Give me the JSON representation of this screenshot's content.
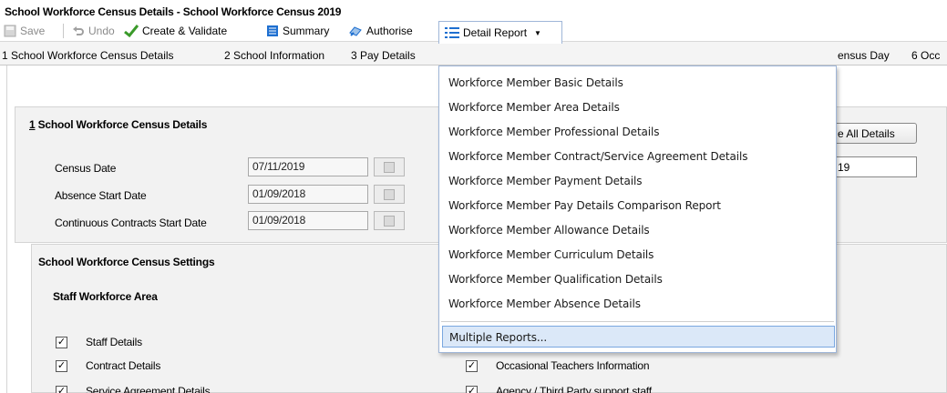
{
  "window": {
    "title": "School Workforce Census Details - School Workforce Census 2019"
  },
  "toolbar": {
    "save": "Save",
    "undo": "Undo",
    "create_validate": "Create & Validate",
    "summary": "Summary",
    "authorise": "Authorise",
    "detail_report": "Detail Report"
  },
  "tabs": [
    "1 School Workforce Census Details",
    "2 School Information",
    "3 Pay Details",
    "ensus Day",
    "6 Occ"
  ],
  "details": {
    "heading_number": "1",
    "heading_text": " School Workforce Census Details",
    "census_date_label": "Census Date",
    "census_date_value": "07/11/2019",
    "absence_start_label": "Absence Start Date",
    "absence_start_value": "01/09/2018",
    "contracts_start_label": "Continuous Contracts Start Date",
    "contracts_start_value": "01/09/2018",
    "all_details_button": "e All Details",
    "right_input_value": "19"
  },
  "settings": {
    "heading": "School Workforce Census Settings",
    "area_heading": "Staff Workforce Area",
    "checkboxes_left": [
      {
        "label": "Staff Details",
        "checked": true
      },
      {
        "label": "Contract Details",
        "checked": true
      },
      {
        "label": "Service Agreement Details",
        "checked": true
      }
    ],
    "checkboxes_right": [
      {
        "label": "Occasional Teachers Information",
        "checked": true
      },
      {
        "label": "Agency / Third Party support staff",
        "checked": true
      }
    ]
  },
  "menu": {
    "items": [
      "Workforce Member Basic Details",
      "Workforce Member Area Details",
      "Workforce Member Professional Details",
      "Workforce Member Contract/Service Agreement Details",
      "Workforce Member Payment Details",
      "Workforce Member Pay Details Comparison Report",
      "Workforce Member Allowance Details",
      "Workforce Member Curriculum Details",
      "Workforce Member Qualification Details",
      "Workforce Member Absence Details"
    ],
    "multiple": "Multiple Reports..."
  },
  "colors": {
    "menu_highlight": "#dbe8f8",
    "menu_border": "#9fb6d8",
    "accent_green": "#3a9a2a",
    "accent_blue": "#1e6fd0"
  }
}
